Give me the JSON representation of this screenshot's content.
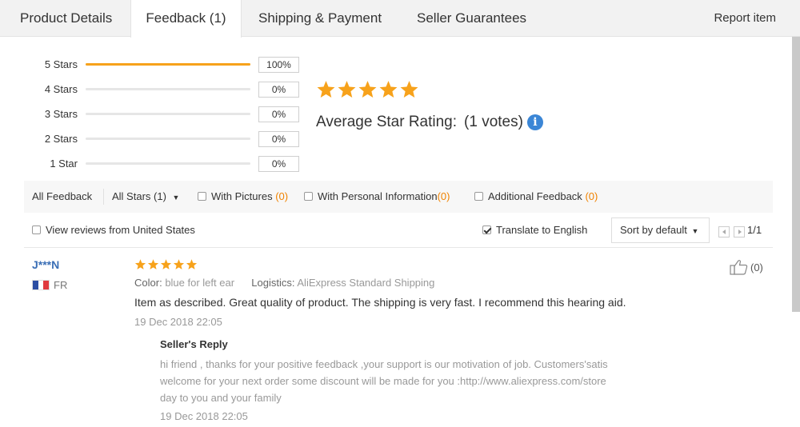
{
  "tabs": [
    {
      "label": "Product Details",
      "active": false
    },
    {
      "label": "Feedback (1)",
      "active": true
    },
    {
      "label": "Shipping & Payment",
      "active": false
    },
    {
      "label": "Seller Guarantees",
      "active": false
    }
  ],
  "report_label": "Report item",
  "rating": {
    "distribution": [
      {
        "label": "5 Stars",
        "percent": 100,
        "percent_text": "100%"
      },
      {
        "label": "4 Stars",
        "percent": 0,
        "percent_text": "0%"
      },
      {
        "label": "3 Stars",
        "percent": 0,
        "percent_text": "0%"
      },
      {
        "label": "2 Stars",
        "percent": 0,
        "percent_text": "0%"
      },
      {
        "label": "1 Star",
        "percent": 0,
        "percent_text": "0%"
      }
    ],
    "stars": 5,
    "average_label": "Average Star Rating:",
    "votes_text": "(1 votes)",
    "info_icon": "i"
  },
  "filters": {
    "all_feedback": "All Feedback",
    "all_stars": "All Stars (1)",
    "with_pictures": "With Pictures",
    "with_pictures_count": "(0)",
    "with_personal": "With Personal Information",
    "with_personal_count": "(0)",
    "additional": "Additional Feedback",
    "additional_count": "(0)",
    "view_us": "View reviews from United States",
    "view_us_checked": false,
    "translate": "Translate to English",
    "translate_checked": true,
    "sort": "Sort by default",
    "page": "1/1"
  },
  "review": {
    "reviewer": "J***N",
    "country": "FR",
    "stars": 5,
    "color_label": "Color:",
    "color_value": "blue for left ear",
    "logistics_label": "Logistics:",
    "logistics_value": "AliExpress Standard Shipping",
    "text": "Item as described. Great quality of product. The shipping is very fast. I recommend this hearing aid.",
    "date": "19 Dec 2018 22:05",
    "helpful_count": "(0)",
    "reply": {
      "title": "Seller's Reply",
      "lines": [
        "hi friend , thanks for your positive feedback ,your support is our motivation of job. Customers'satis",
        "welcome for your next order some discount will be made for you :http://www.aliexpress.com/store",
        "day to you and your family"
      ],
      "date": "19 Dec 2018 22:05"
    }
  },
  "colors": {
    "accent": "#f7a21b",
    "link": "#3b6fb6",
    "count": "#f08200"
  }
}
